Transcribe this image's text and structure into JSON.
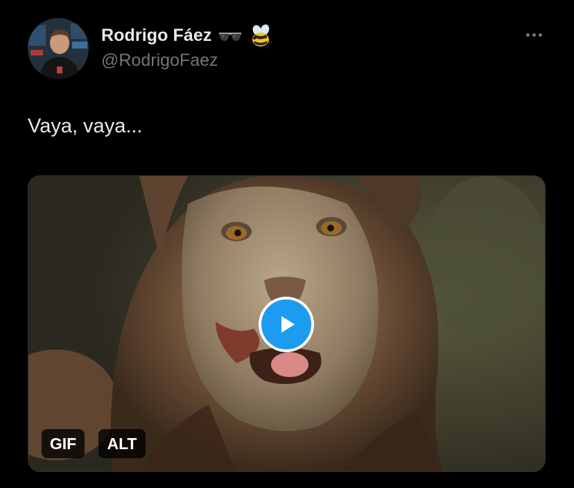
{
  "author": {
    "display_name": "Rodrigo Fáez",
    "handle": "@RodrigoFaez",
    "name_emojis": [
      "sunglasses-icon",
      "bee-icon"
    ]
  },
  "tweet": {
    "text": "Vaya, vaya..."
  },
  "media": {
    "type": "gif",
    "badges": {
      "gif": "GIF",
      "alt": "ALT"
    },
    "play_icon": "play-icon"
  },
  "menu": {
    "icon": "more-options-icon"
  },
  "colors": {
    "background": "#000000",
    "primary_text": "#e7e9ea",
    "secondary_text": "#71767b",
    "accent": "#1d9bf0"
  }
}
